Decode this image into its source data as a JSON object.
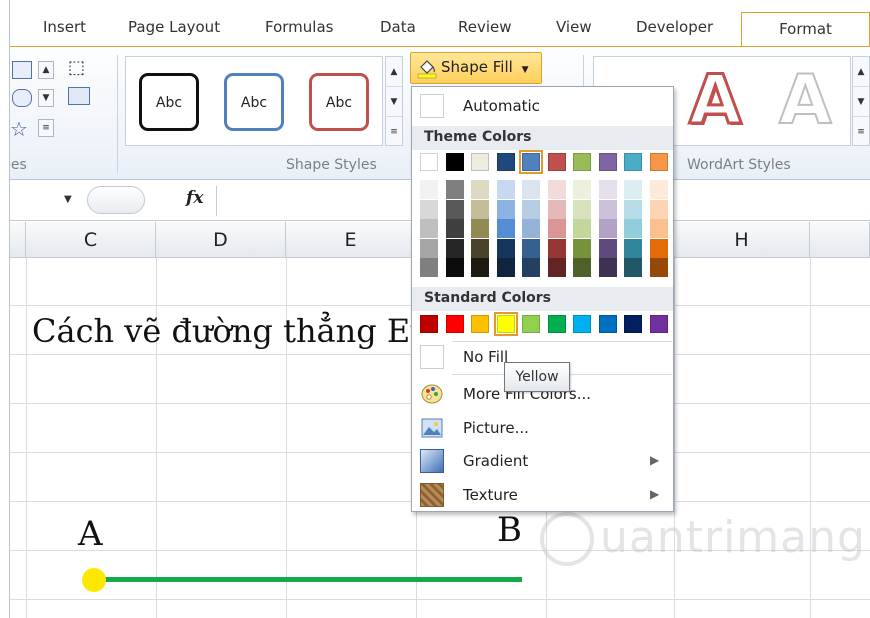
{
  "ribbon": {
    "tabs": [
      "Insert",
      "Page Layout",
      "Formulas",
      "Data",
      "Review",
      "View",
      "Developer",
      "Format"
    ],
    "active_tab": "Format",
    "group_insert_shapes_label": "pes",
    "group_shape_styles_label": "Shape Styles",
    "group_wordart_label": "WordArt Styles",
    "shape_style_samples": [
      "Abc",
      "Abc",
      "Abc"
    ],
    "shape_fill_label": "Shape Fill",
    "wordart_samples": [
      "A",
      "A"
    ]
  },
  "formula_bar": {
    "fx_label": "fx"
  },
  "sheet": {
    "columns": [
      "C",
      "D",
      "E",
      "H"
    ],
    "title_cell": "Cách vẽ đường thẳng Ex",
    "label_a": "A",
    "label_b": "B"
  },
  "shape_fill_menu": {
    "automatic_label": "Automatic",
    "theme_colors_label": "Theme Colors",
    "theme_colors": [
      "#ffffff",
      "#000000",
      "#eeece1",
      "#1f497d",
      "#4f81bd",
      "#c0504d",
      "#9bbb59",
      "#8064a2",
      "#4bacc6",
      "#f79646"
    ],
    "theme_shades": [
      [
        "#f2f2f2",
        "#d8d8d8",
        "#bfbfbf",
        "#a5a5a5",
        "#7f7f7f"
      ],
      [
        "#7f7f7f",
        "#595959",
        "#3f3f3f",
        "#262626",
        "#0c0c0c"
      ],
      [
        "#ddd9c3",
        "#c4bd97",
        "#938953",
        "#494429",
        "#1d1b10"
      ],
      [
        "#c6d9f0",
        "#8db3e2",
        "#548dd4",
        "#17365d",
        "#0f243e"
      ],
      [
        "#dbe5f1",
        "#b8cce4",
        "#95b3d7",
        "#366092",
        "#244061"
      ],
      [
        "#f2dcdb",
        "#e5b9b7",
        "#d99694",
        "#953734",
        "#632423"
      ],
      [
        "#ebf1dd",
        "#d7e3bc",
        "#c3d69b",
        "#76923c",
        "#4f6128"
      ],
      [
        "#e5e0ec",
        "#ccc1d9",
        "#b2a2c7",
        "#5f497a",
        "#3f3151"
      ],
      [
        "#dbeef3",
        "#b7dde8",
        "#92cddc",
        "#31859b",
        "#205867"
      ],
      [
        "#fdeada",
        "#fbd5b5",
        "#fac08f",
        "#e36c09",
        "#974806"
      ]
    ],
    "standard_colors_label": "Standard Colors",
    "standard_colors": [
      "#c00000",
      "#ff0000",
      "#ffc000",
      "#ffff00",
      "#92d050",
      "#00b050",
      "#00b0f0",
      "#0070c0",
      "#002060",
      "#7030a0"
    ],
    "selected_theme_index": 4,
    "selected_standard_index": 3,
    "no_fill_label": "No Fill",
    "more_colors_label": "More Fill Colors...",
    "picture_label": "Picture...",
    "gradient_label": "Gradient",
    "texture_label": "Texture",
    "tooltip": "Yellow"
  },
  "colors": {
    "line_green": "#16a84a",
    "point_yellow": "#ffe800",
    "accent_orange": "#e0a12f"
  },
  "watermark": "uantrimang"
}
